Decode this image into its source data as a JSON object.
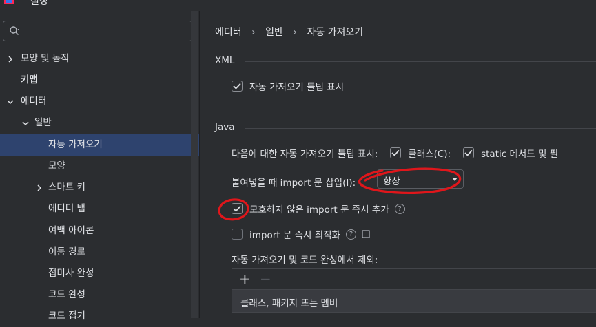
{
  "window": {
    "title": "설정"
  },
  "search": {
    "value": "",
    "placeholder": ""
  },
  "sidebar": {
    "items": [
      {
        "label": "모양 및 동작"
      },
      {
        "label": "키맵"
      },
      {
        "label": "에디터"
      },
      {
        "label": "일반"
      },
      {
        "label": "자동 가져오기"
      },
      {
        "label": "모양"
      },
      {
        "label": "스마트 키"
      },
      {
        "label": "에디터 탭"
      },
      {
        "label": "여백 아이콘"
      },
      {
        "label": "이동 경로"
      },
      {
        "label": "접미사 완성"
      },
      {
        "label": "코드 완성"
      },
      {
        "label": "코드 접기"
      }
    ]
  },
  "breadcrumb": {
    "part1": "에디터",
    "part2": "일반",
    "part3": "자동 가져오기"
  },
  "xml": {
    "title": "XML",
    "tooltip_label": "자동 가져오기 툴팁 표시"
  },
  "java": {
    "title": "Java",
    "tooltip_row_label": "다음에 대한 자동 가져오기 툴팁 표시:",
    "classes_label": "클래스(C):",
    "static_label": "static 메서드 및 필",
    "paste_label": "붙여넣을 때 import 문 삽입(I):",
    "paste_value": "항상",
    "unambiguous_label": "모호하지 않은 import 문 즉시 추가",
    "optimize_label": "import 문 즉시 최적화",
    "exclude_label": "자동 가져오기 및 코드 완성에서 제외:",
    "add_symbol": "+",
    "remove_symbol": "−",
    "list_header": "클래스, 패키지 또는 멤버"
  },
  "colors": {
    "accent": "#2e436e",
    "annotation": "#e0161b"
  }
}
